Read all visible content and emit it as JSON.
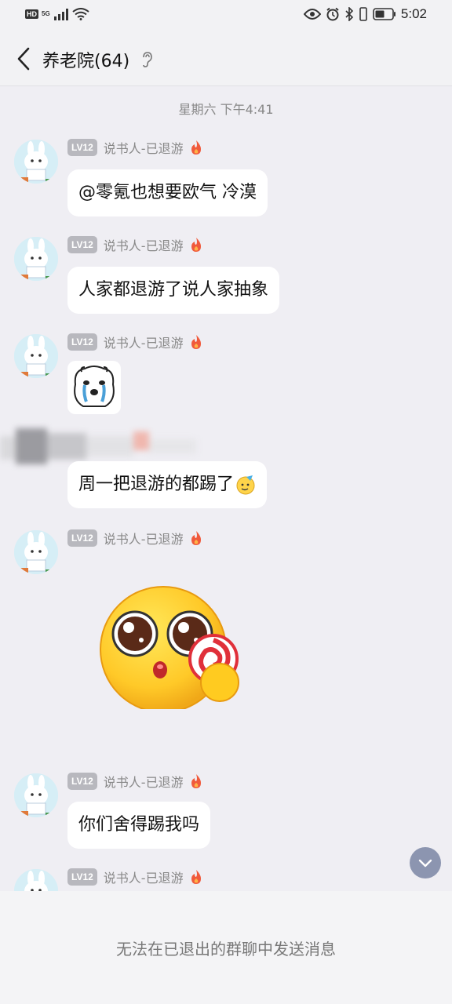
{
  "status_bar": {
    "hd": "HD",
    "network": "5G",
    "time": "5:02"
  },
  "header": {
    "title": "养老院(64)"
  },
  "chat": {
    "time_label": "星期六 下午4:41",
    "messages": [
      {
        "level": "LV12",
        "nickname": "说书人-已退游",
        "text": "@零氪也想要欧气 冷漠"
      },
      {
        "level": "LV12",
        "nickname": "说书人-已退游",
        "text": "人家都退游了说人家抽象"
      },
      {
        "level": "LV12",
        "nickname": "说书人-已退游",
        "text": ""
      },
      {
        "level": "",
        "nickname": "",
        "text": "周一把退游的都踢了"
      },
      {
        "level": "LV12",
        "nickname": "说书人-已退游",
        "text": ""
      },
      {
        "level": "LV12",
        "nickname": "说书人-已退游",
        "text": "你们舍得踢我吗"
      },
      {
        "level": "LV12",
        "nickname": "说书人-已退游",
        "text": ""
      }
    ]
  },
  "footer": {
    "notice": "无法在已退出的群聊中发送消息"
  },
  "colors": {
    "background": "#efeef3",
    "bubble": "#ffffff",
    "badge": "#b8b8be",
    "scroll_button": "#8c95b0"
  }
}
